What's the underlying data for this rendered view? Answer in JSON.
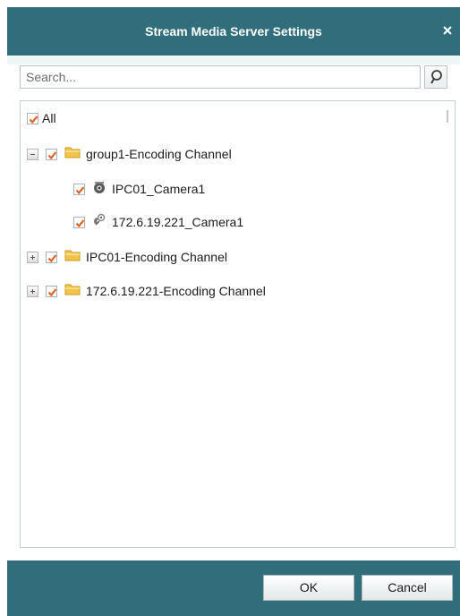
{
  "dialog": {
    "title": "Stream Media Server Settings",
    "close_glyph": "×"
  },
  "search": {
    "placeholder": "Search..."
  },
  "tree": {
    "all_label": "All",
    "groups": [
      {
        "label": "group1-Encoding Channel",
        "expanded": true,
        "checked": true,
        "children": [
          {
            "label": "IPC01_Camera1",
            "checked": true,
            "icon": "camera-dome-icon"
          },
          {
            "label": "172.6.19.221_Camera1",
            "checked": true,
            "icon": "camera-link-icon"
          }
        ]
      },
      {
        "label": "IPC01-Encoding Channel",
        "expanded": false,
        "checked": true
      },
      {
        "label": "172.6.19.221-Encoding Channel",
        "expanded": false,
        "checked": true
      }
    ]
  },
  "footer": {
    "ok_label": "OK",
    "cancel_label": "Cancel"
  },
  "colors": {
    "header": "#2f6e7a",
    "check": "#e0672a",
    "folder": "#f2c54a"
  }
}
